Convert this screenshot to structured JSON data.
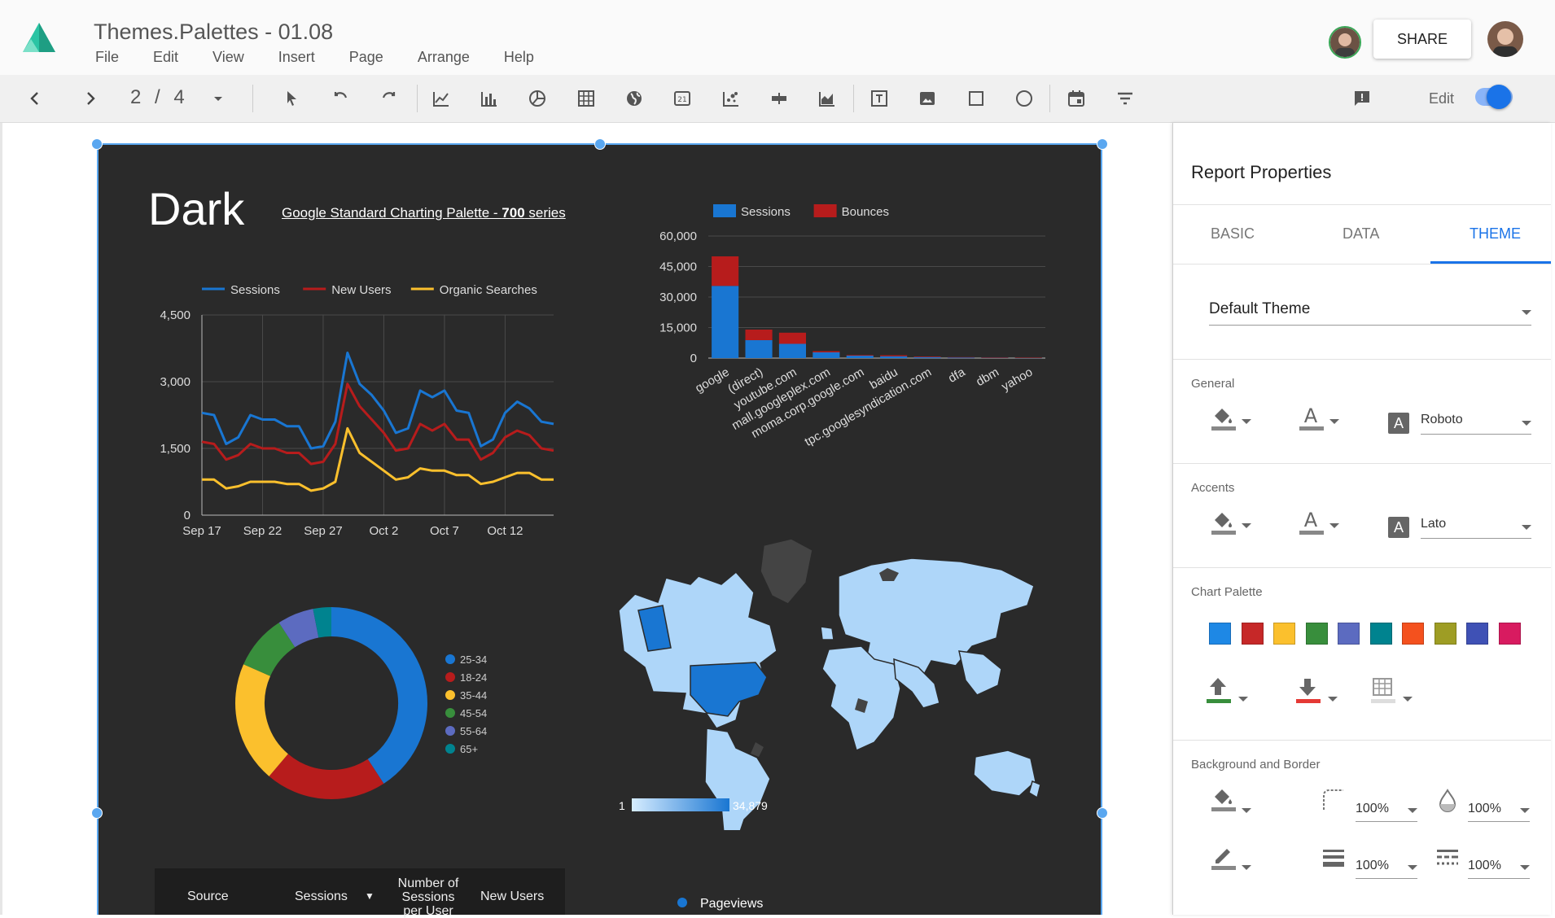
{
  "app": {
    "title": "Themes.Palettes - 01.08",
    "menu": [
      "File",
      "Edit",
      "View",
      "Insert",
      "Page",
      "Arrange",
      "Help"
    ],
    "share_label": "SHARE",
    "edit_label": "Edit"
  },
  "toolbar": {
    "page_current": "2",
    "page_sep": "/",
    "page_total": "4",
    "icons": [
      "back-arrow-icon",
      "forward-arrow-icon",
      "pointer-icon",
      "undo-icon",
      "redo-icon",
      "time-series-icon",
      "bar-chart-icon",
      "pie-chart-icon",
      "table-icon",
      "geo-map-icon",
      "scorecard-icon",
      "scatter-chart-icon",
      "bullet-chart-icon",
      "area-chart-icon",
      "text-icon",
      "image-icon",
      "rectangle-icon",
      "circle-icon",
      "date-range-icon",
      "filter-icon",
      "feedback-icon"
    ]
  },
  "report": {
    "heading": "Dark",
    "palette_link_prefix": "Google Standard Charting Palette - ",
    "palette_link_bold": "700",
    "palette_link_suffix": " series"
  },
  "colors": {
    "blue": "#1976d2",
    "red": "#b71c1c",
    "yellow": "#fbc02d",
    "green": "#388e3c",
    "purple": "#5c6bc0",
    "teal": "#00838f",
    "background": "#2a2a2a",
    "accent": "#1a73e8"
  },
  "chart_data": [
    {
      "type": "line",
      "legend": [
        "Sessions",
        "New Users",
        "Organic Searches"
      ],
      "x_ticks": [
        "Sep 17",
        "Sep 22",
        "Sep 27",
        "Oct 2",
        "Oct 7",
        "Oct 12"
      ],
      "y_ticks": [
        "4,500",
        "3,000",
        "1,500",
        "0"
      ],
      "ylim": [
        0,
        4500
      ],
      "grid": true,
      "legend_position": "top",
      "series": [
        {
          "name": "Sessions",
          "values": [
            2300,
            2250,
            1600,
            1750,
            2250,
            2150,
            2150,
            2000,
            2000,
            1500,
            1550,
            2100,
            3650,
            2950,
            2700,
            2350,
            1850,
            1950,
            2800,
            2650,
            2800,
            2350,
            2300,
            1550,
            1700,
            2300,
            2550,
            2400,
            2100,
            2050
          ]
        },
        {
          "name": "New Users",
          "values": [
            1650,
            1600,
            1250,
            1350,
            1600,
            1500,
            1500,
            1400,
            1400,
            1150,
            1200,
            1600,
            2950,
            2450,
            2150,
            1850,
            1450,
            1500,
            2050,
            1900,
            2050,
            1700,
            1700,
            1250,
            1400,
            1750,
            1900,
            1800,
            1500,
            1450
          ]
        },
        {
          "name": "Organic Searches",
          "values": [
            800,
            800,
            600,
            650,
            750,
            750,
            750,
            700,
            700,
            550,
            600,
            750,
            1950,
            1400,
            1200,
            1000,
            800,
            850,
            1050,
            1000,
            1000,
            900,
            900,
            700,
            750,
            850,
            950,
            950,
            800,
            800
          ]
        }
      ]
    },
    {
      "type": "bar",
      "stacked": true,
      "legend": [
        "Sessions",
        "Bounces"
      ],
      "legend_position": "top",
      "categories": [
        "google",
        "(direct)",
        "youtube.com",
        "mall.googleplex.com",
        "moma.corp.google.com",
        "baidu",
        "tpc.googlesyndication.com",
        "dfa",
        "dbm",
        "yahoo"
      ],
      "y_ticks": [
        "60,000",
        "45,000",
        "30,000",
        "15,000",
        "0"
      ],
      "ylim": [
        0,
        60000
      ],
      "series": [
        {
          "name": "Sessions",
          "values": [
            35500,
            8800,
            7000,
            2800,
            1200,
            900,
            500,
            300,
            200,
            150
          ]
        },
        {
          "name": "Bounces",
          "values": [
            14500,
            5200,
            5500,
            600,
            300,
            500,
            300,
            200,
            100,
            100
          ]
        }
      ]
    },
    {
      "type": "pie",
      "donut": true,
      "legend_position": "right",
      "categories": [
        "25-34",
        "18-24",
        "35-44",
        "45-54",
        "55-64",
        "65+"
      ],
      "values": [
        40,
        20,
        20,
        9,
        6,
        3
      ]
    }
  ],
  "map": {
    "scale_min": "1",
    "scale_max": "34,879",
    "legend": "Pageviews"
  },
  "table": {
    "columns": [
      "Source",
      "Sessions",
      "Number of Sessions per User",
      "New Users"
    ]
  },
  "panel": {
    "title": "Report Properties",
    "tabs": [
      "BASIC",
      "DATA",
      "THEME"
    ],
    "theme_value": "Default Theme",
    "sections": {
      "general": "General",
      "accents": "Accents",
      "chart_palette": "Chart Palette",
      "background": "Background and Border"
    },
    "general_font": "Roboto",
    "accents_font": "Lato",
    "font_badge": "A",
    "palette_swatches": [
      "#1e88e5",
      "#c62828",
      "#fbc02d",
      "#388e3c",
      "#5c6bc0",
      "#00838f",
      "#f4511e",
      "#9e9d24",
      "#3f51b5",
      "#d81b60"
    ],
    "bg_opacity_1": "100%",
    "bg_opacity_2": "100%",
    "border_opacity_1": "100%",
    "border_opacity_2": "100%"
  }
}
